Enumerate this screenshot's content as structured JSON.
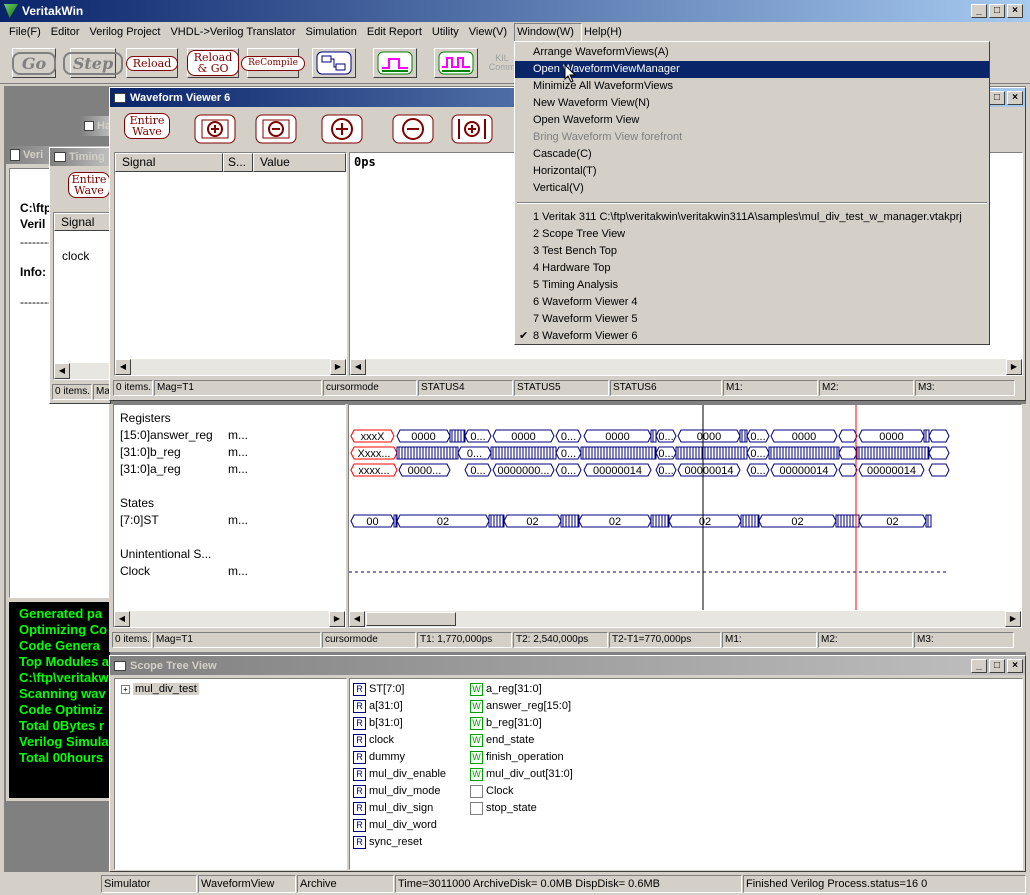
{
  "app": {
    "title": "VeritakWin"
  },
  "menubar": [
    "File(F)",
    "Editor",
    "Verilog Project",
    "VHDL->Verilog Translator",
    "Simulation",
    "Edit Report",
    "Utility",
    "View(V)",
    "Window(W)",
    "Help(H)"
  ],
  "toolbar": {
    "go": "Go",
    "step": "Step",
    "reload": "Reload",
    "reload_go_1": "Reload",
    "reload_go_2": "& GO",
    "recompile": "ReCompile",
    "kill_1": "KIL",
    "kill_2": "Comm"
  },
  "window_menu": {
    "items": [
      "Arrange WaveformViews(A)",
      "Open WaveformViewManager",
      "Minimize All WaveformViews",
      "New Waveform View(N)",
      "Open Waveform View",
      "Bring Waveform View forefront",
      "Cascade(C)",
      "Horizontal(T)",
      "Vertical(V)"
    ],
    "recent": [
      "1 Veritak 311 C:\\ftp\\veritakwin\\veritakwin311A\\samples\\mul_div_test_w_manager.vtakprj",
      "2 Scope Tree View",
      "3 Test Bench Top",
      "4 Hardware Top",
      "5 Timing Analysis",
      "6 Waveform Viewer 4",
      "7 Waveform Viewer 5",
      "8 Waveform Viewer 6"
    ],
    "check": "✔"
  },
  "wv6": {
    "title": "Waveform Viewer 6",
    "entire_1": "Entire",
    "entire_2": "Wave",
    "col_signal": "Signal",
    "col_s": "S...",
    "col_value": "Value",
    "time": "0ps",
    "status": [
      "0 items.",
      "Mag=T1",
      "cursormode",
      "STATUS4",
      "STATUS5",
      "STATUS6",
      "M1:",
      "M2:",
      "M3:"
    ]
  },
  "timing": {
    "title": "Timing",
    "entire_1": "Entire",
    "entire_2": "Wave",
    "col_signal": "Signal",
    "signal": "clock",
    "status": [
      "0 items.",
      "Ma"
    ]
  },
  "verilog_win": {
    "title": "Veri",
    "line1": "C:\\ftp",
    "line2": "Veril",
    "dash": "--------",
    "info": "Info:",
    "dash2": "--------"
  },
  "hw_title": "Ha",
  "console": [
    "Generated pa",
    "Optimizing Co",
    "Code Genera",
    "Top Modules a",
    "C:\\ftp\\veritakw",
    "Scanning wav",
    "Code Optimiz",
    "Total 0Bytes r",
    "Verilog Simula",
    "Total  00hours"
  ],
  "wv_lower": {
    "groups": [
      {
        "label": "Registers"
      },
      {
        "label": "States"
      },
      {
        "label": "Unintentional S..."
      }
    ],
    "signals": [
      {
        "name": "[15:0]answer_reg",
        "m": "m..."
      },
      {
        "name": "[31:0]b_reg",
        "m": "m..."
      },
      {
        "name": "[31:0]a_reg",
        "m": "m..."
      },
      {
        "name": "[7:0]ST",
        "m": "m..."
      },
      {
        "name": "Clock",
        "m": "m..."
      }
    ],
    "answer_vals": [
      "xxxX",
      "0000",
      "0...",
      "0000",
      "0...",
      "0000",
      "0...",
      "0000",
      "0...",
      "0000",
      "0...",
      "0000",
      "0..."
    ],
    "b_vals": [
      "Xxxx...",
      "0...",
      "0...",
      "0...",
      "0...",
      "0...",
      "0..."
    ],
    "a_vals": [
      "xxxx...",
      "0000...",
      "0...",
      "0000000...",
      "0...",
      "00000014",
      "0...",
      "00000014",
      "0...",
      "00000014",
      "0...",
      "00000014"
    ],
    "st_vals": [
      "00",
      "02",
      "02",
      "02",
      "02",
      "02",
      "02"
    ],
    "status": [
      "0 items.",
      "Mag=T1",
      "cursormode",
      "T1: 1,770,000ps",
      "T2: 2,540,000ps",
      "T2-T1=770,000ps",
      "M1:",
      "M2:",
      "M3:"
    ]
  },
  "scope": {
    "title": "Scope Tree View",
    "root": "mul_div_test",
    "col1": [
      {
        "t": "R",
        "n": "ST[7:0]"
      },
      {
        "t": "R",
        "n": "a[31:0]"
      },
      {
        "t": "R",
        "n": "b[31:0]"
      },
      {
        "t": "R",
        "n": "clock"
      },
      {
        "t": "R",
        "n": "dummy"
      },
      {
        "t": "R",
        "n": "mul_div_enable"
      },
      {
        "t": "R",
        "n": "mul_div_mode"
      },
      {
        "t": "R",
        "n": "mul_div_sign"
      },
      {
        "t": "R",
        "n": "mul_div_word"
      },
      {
        "t": "R",
        "n": "sync_reset"
      }
    ],
    "col2": [
      {
        "t": "W",
        "n": "a_reg[31:0]"
      },
      {
        "t": "W",
        "n": "answer_reg[15:0]"
      },
      {
        "t": "W",
        "n": "b_reg[31:0]"
      },
      {
        "t": "W",
        "n": "end_state"
      },
      {
        "t": "W",
        "n": "finish_operation"
      },
      {
        "t": "W",
        "n": "mul_div_out[31:0]"
      },
      {
        "t": "",
        "n": "Clock"
      },
      {
        "t": "",
        "n": "stop_state"
      }
    ]
  },
  "statusbar": [
    "Simulator",
    "WaveformView",
    "Archive",
    "Time=3011000 ArchiveDisk=  0.0MB DispDisk=  0.6MB",
    "Finished Verilog Process.status=16 0"
  ]
}
